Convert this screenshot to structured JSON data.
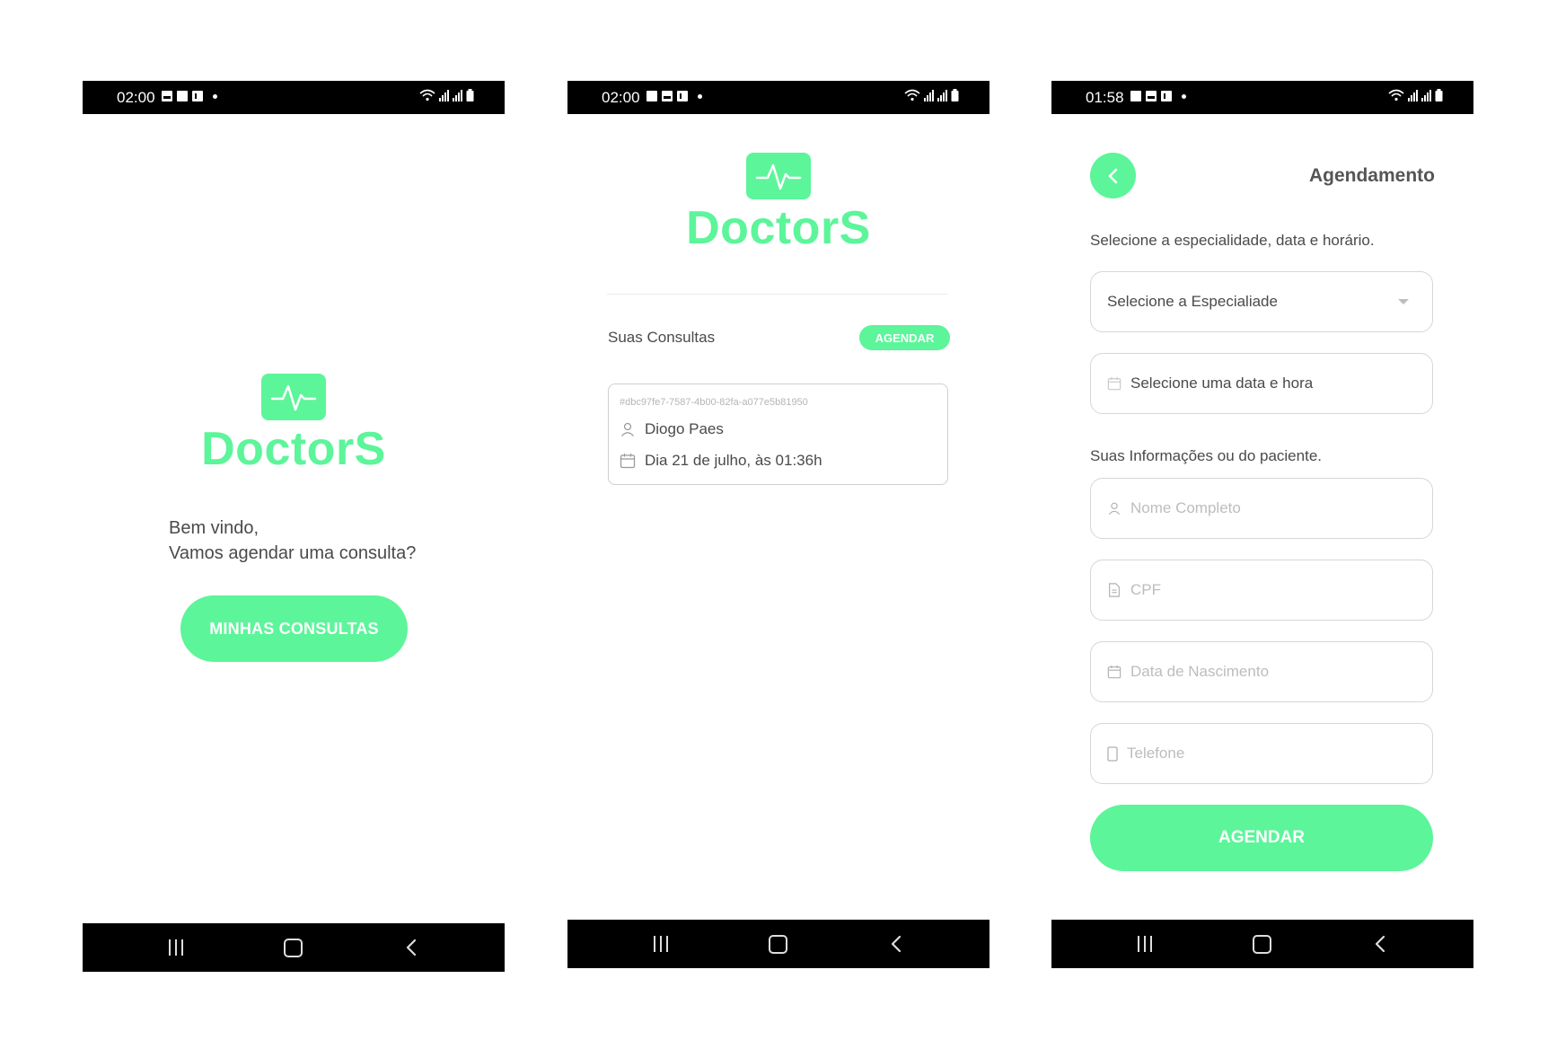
{
  "colors": {
    "accent": "#5cf59a",
    "text": "#4a4a4a",
    "placeholder": "#bdbdbd",
    "border": "#d6d6d6"
  },
  "screens": [
    {
      "status": {
        "time": "02:00"
      },
      "logo_text": "DoctorS",
      "welcome_line1": "Bem vindo,",
      "welcome_line2": "Vamos agendar uma consulta?",
      "button_label": "MINHAS CONSULTAS",
      "nav": {
        "recent_icon": "recent-apps-icon",
        "home_icon": "home-icon",
        "back_icon": "back-icon"
      }
    },
    {
      "status": {
        "time": "02:00"
      },
      "logo_text": "DoctorS",
      "section_title": "Suas Consultas",
      "schedule_button": "AGENDAR",
      "appointment": {
        "id": "#dbc97fe7-7587-4b00-82fa-a077e5b81950",
        "patient": "Diogo Paes",
        "datetime": "Dia 21 de julho, às  01:36h"
      }
    },
    {
      "status": {
        "time": "01:58"
      },
      "title": "Agendamento",
      "instruction": "Selecione a especialidade, data e horário.",
      "specialty_select": "Selecione a Especialiade",
      "datetime_field": "Selecione uma data e hora",
      "info_label": "Suas Informações ou do paciente.",
      "fields": {
        "name_placeholder": "Nome Completo",
        "cpf_placeholder": "CPF",
        "birth_placeholder": "Data de Nascimento",
        "phone_placeholder": "Telefone"
      },
      "submit_label": "AGENDAR"
    }
  ]
}
